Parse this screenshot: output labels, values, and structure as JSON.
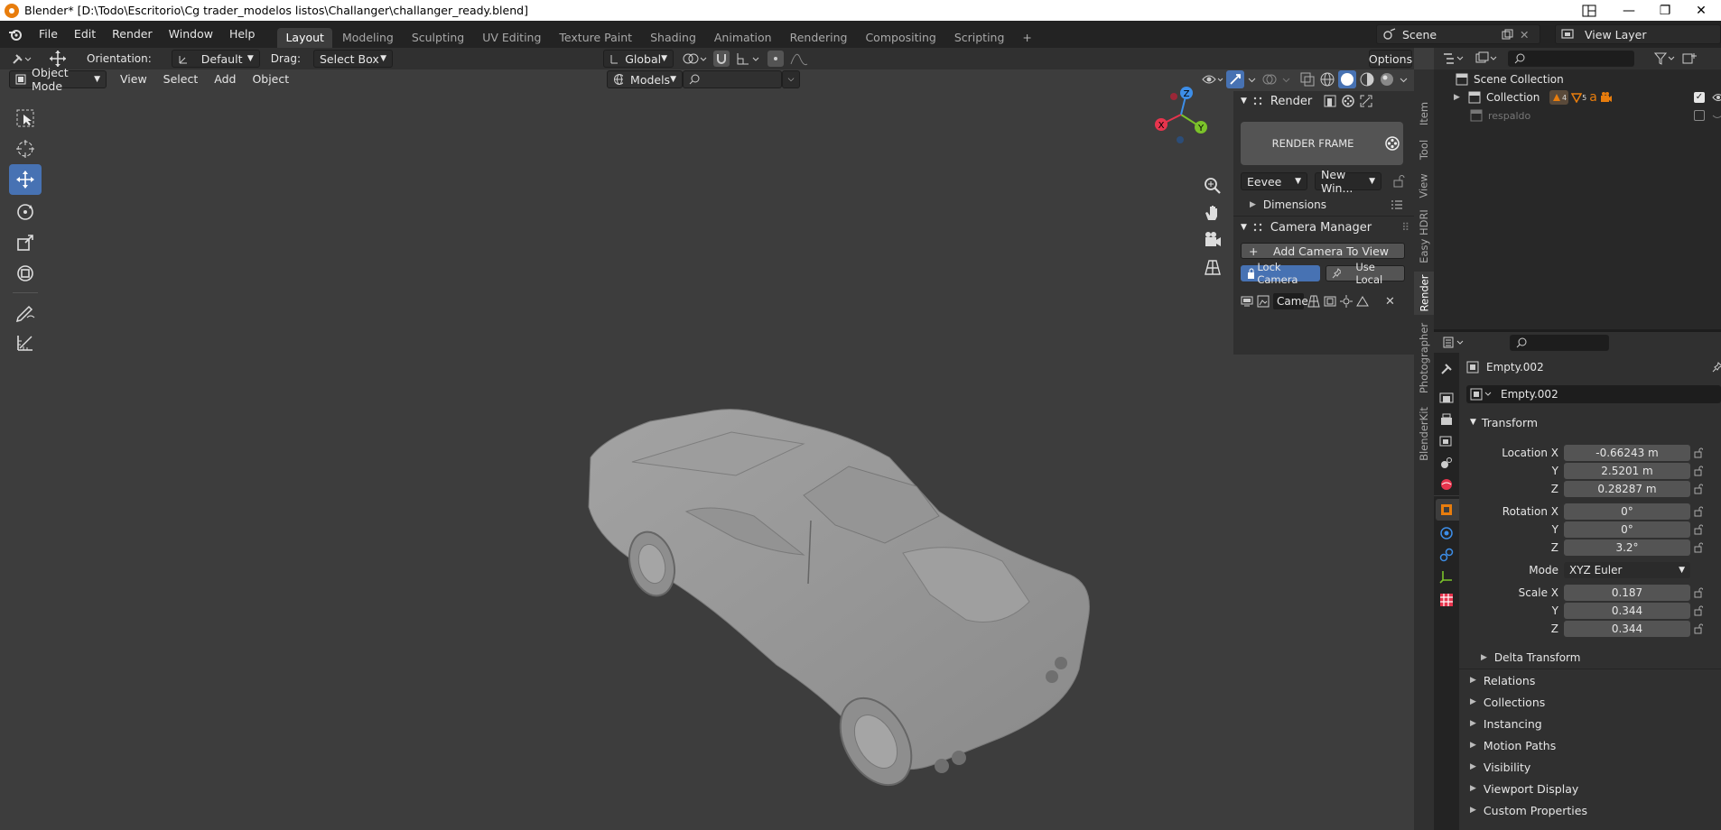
{
  "window": {
    "title": "Blender* [D:\\Todo\\Escritorio\\Cg trader_modelos listos\\Challanger\\challanger_ready.blend]",
    "minimize": "—",
    "maximize": "❐",
    "close": "✕"
  },
  "menubar": {
    "items": [
      "File",
      "Edit",
      "Render",
      "Window",
      "Help"
    ],
    "workspaces": [
      "Layout",
      "Modeling",
      "Sculpting",
      "UV Editing",
      "Texture Paint",
      "Shading",
      "Animation",
      "Rendering",
      "Compositing",
      "Scripting"
    ],
    "active_workspace": "Layout",
    "scene": "Scene",
    "view_layer": "View Layer"
  },
  "tool_header": {
    "orientation_label": "Orientation:",
    "orientation_value": "Default",
    "drag_label": "Drag:",
    "drag_value": "Select Box",
    "transform_orientation": "Global",
    "options": "Options"
  },
  "view_header": {
    "mode": "Object Mode",
    "menus": [
      "View",
      "Select",
      "Add",
      "Object"
    ],
    "models_dropdown": "Models"
  },
  "gizmo": {
    "x": "X",
    "y": "Y",
    "z": "Z"
  },
  "n_panel": {
    "render_title": "Render",
    "render_frame": "RENDER FRAME",
    "engine": "Eevee",
    "output": "New Win...",
    "dimensions": "Dimensions",
    "camera_manager": "Camera Manager",
    "add_camera": "Add Camera To View",
    "lock_camera": "Lock Camera",
    "use_local": "Use Local",
    "camera_field": "Came"
  },
  "side_tabs": [
    "Item",
    "Tool",
    "View",
    "Easy HDRI",
    "Render",
    "Photographer",
    "BlenderKit"
  ],
  "outliner": {
    "scene_collection": "Scene Collection",
    "collection": "Collection",
    "respaldo": "respaldo",
    "badge_1": "4",
    "badge_2": "5"
  },
  "properties": {
    "object_name": "Empty.002",
    "object_field": "Empty.002",
    "transform": "Transform",
    "location_label": "Location X",
    "location": [
      "-0.66243 m",
      "2.5201 m",
      "0.28287 m"
    ],
    "rotation_label": "Rotation X",
    "rotation": [
      "0°",
      "0°",
      "3.2°"
    ],
    "mode_label": "Mode",
    "mode_value": "XYZ Euler",
    "scale_label": "Scale X",
    "scale": [
      "0.187",
      "0.344",
      "0.344"
    ],
    "axis_y": "Y",
    "axis_z": "Z",
    "delta_transform": "Delta Transform",
    "sections": [
      "Relations",
      "Collections",
      "Instancing",
      "Motion Paths",
      "Visibility",
      "Viewport Display",
      "Custom Properties"
    ]
  },
  "colors": {
    "accent": "#4772b3",
    "orange": "#e87d0d",
    "axis_x": "#e7344d",
    "axis_y": "#7bc22a",
    "axis_z": "#3d8ee8"
  }
}
